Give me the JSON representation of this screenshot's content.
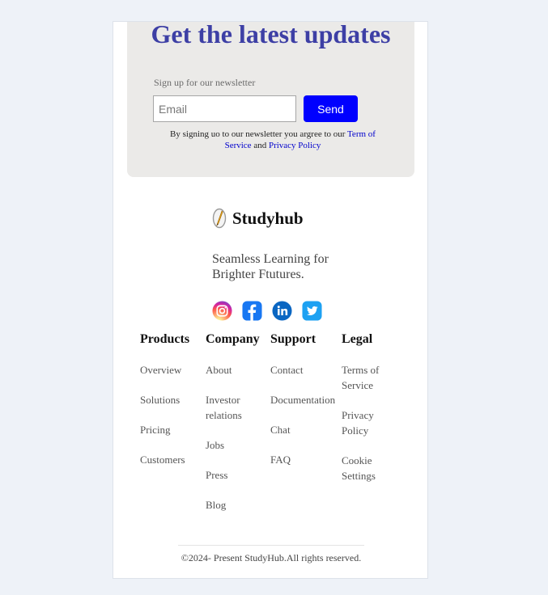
{
  "newsletter": {
    "title": "Get the latest updates",
    "subtitle": "Sign up for our newsletter",
    "email_placeholder": "Email",
    "send_label": "Send",
    "terms_prefix": "By signing uo to our newsletter you argree to our ",
    "terms_link": "Term of Service",
    "terms_and": " and ",
    "privacy_link": "Privacy Policy"
  },
  "brand": {
    "name": "Studyhub",
    "tagline": "Seamless Learning for Brighter Ftutures."
  },
  "socials": [
    "instagram-icon",
    "facebook-icon",
    "linkedin-icon",
    "twitter-icon"
  ],
  "footer": {
    "columns": [
      {
        "heading": "Products",
        "items": [
          "Overview",
          "Solutions",
          "Pricing",
          "Customers"
        ]
      },
      {
        "heading": "Company",
        "items": [
          "About",
          "Investor relations",
          "Jobs",
          "Press",
          "Blog"
        ]
      },
      {
        "heading": "Support",
        "items": [
          "Contact",
          "Documentation",
          "Chat",
          "FAQ"
        ]
      },
      {
        "heading": "Legal",
        "items": [
          "Terms of Service",
          "Privacy Policy",
          "Cookie Settings"
        ]
      }
    ],
    "copyright": "©2024- Present StudyHub.All rights reserved."
  },
  "colors": {
    "accent": "#0000ff",
    "title": "#3d3fa5",
    "panel": "#ebeae8",
    "page": "#eef2f8"
  }
}
